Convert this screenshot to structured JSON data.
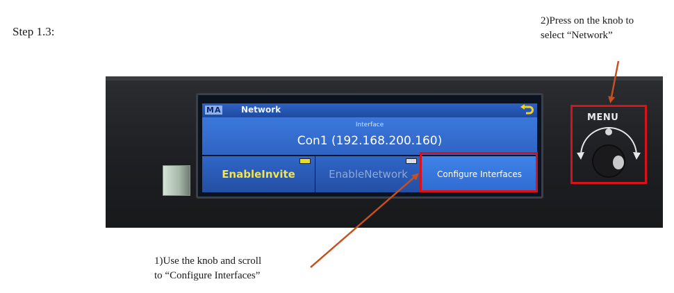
{
  "step": {
    "label": "Step 1.3:"
  },
  "notes": {
    "press_line1": "2)Press on the knob to",
    "press_line2": "select “Network”",
    "scroll_line1": "1)Use the knob and scroll",
    "scroll_line2": "to “Configure Interfaces”"
  },
  "screen": {
    "logo": "MA",
    "title": "Network",
    "interface_label": "Interface",
    "interface_value": "Con1 (192.168.200.160)",
    "buttons": [
      {
        "label": "EnableInvite",
        "indicator": "yellow"
      },
      {
        "label": "EnableNetwork",
        "indicator": "white"
      },
      {
        "label": "Configure Interfaces"
      }
    ]
  },
  "device": {
    "menu_label": "MENU"
  },
  "colors": {
    "highlight": "#d8121b",
    "arrow": "#c8501e",
    "screen_blue": "#2f64c3"
  },
  "icons": [
    "back-arrow-icon",
    "menu-knob-icon",
    "rotate-arrows-icon"
  ]
}
